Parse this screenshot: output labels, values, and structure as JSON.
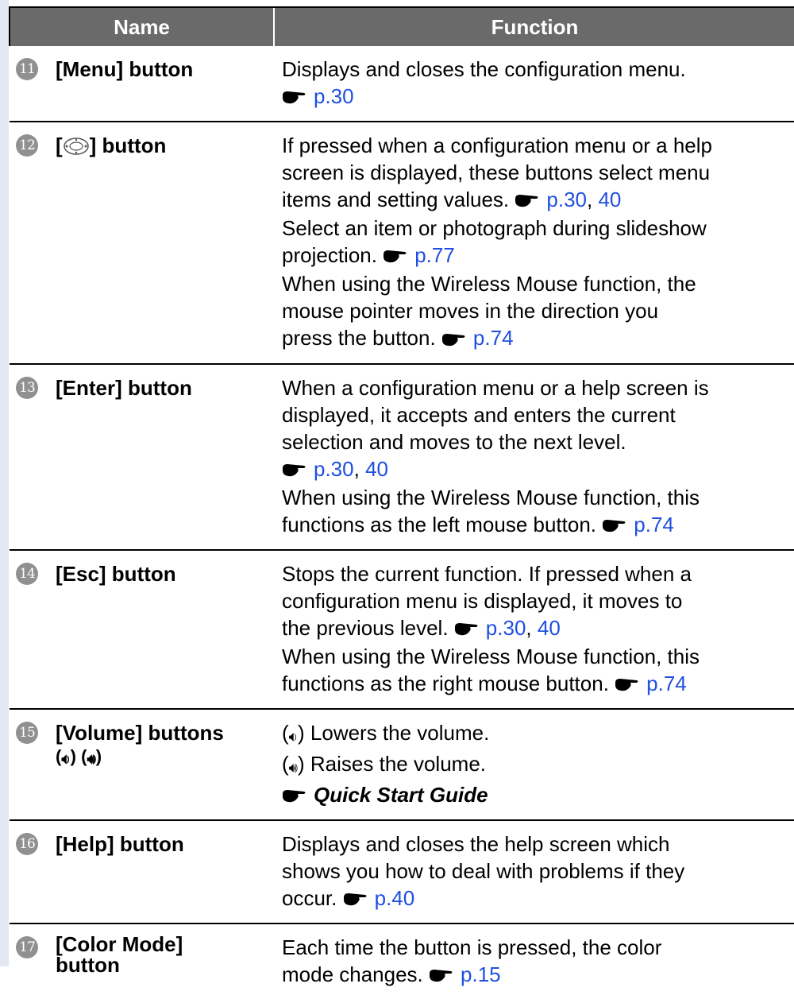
{
  "table": {
    "headers": {
      "name": "Name",
      "function": "Function"
    },
    "rows": [
      {
        "num": "11",
        "name": "[Menu] button",
        "lines": [
          "Displays and closes the configuration menu."
        ],
        "ref_lines": [
          [
            "p.30"
          ]
        ]
      },
      {
        "num": "12",
        "name_prefix": "[",
        "name_suffix": "] button",
        "lines": [
          "If pressed when a configuration menu or a help",
          "screen is displayed, these buttons select menu",
          "items and setting values.",
          "Select an item or photograph during slideshow",
          "projection.",
          "When using the Wireless Mouse function, the",
          "mouse pointer moves in the direction you",
          "press the button."
        ],
        "refs": {
          "a": "p.30",
          "b": "40",
          "c": "p.77",
          "d": "p.74"
        }
      },
      {
        "num": "13",
        "name": "[Enter] button",
        "lines": [
          "When a configuration menu or a help screen is",
          "displayed, it accepts and enters the current",
          "selection and moves to the next level.",
          "When using the Wireless Mouse function, this",
          "functions as the left mouse button."
        ],
        "refs": {
          "a": "p.30",
          "b": "40",
          "c": "p.74"
        }
      },
      {
        "num": "14",
        "name": "[Esc] button",
        "lines": [
          "Stops the current function. If pressed when a",
          "configuration menu is displayed, it moves to",
          "the previous level.",
          "When using the Wireless Mouse function, this",
          "functions as the right mouse button."
        ],
        "refs": {
          "a": "p.30",
          "b": "40",
          "c": "p.74"
        }
      },
      {
        "num": "15",
        "name_line1": "[Volume] buttons",
        "name_line2": "( ) ( )",
        "lines": [
          ") Lowers the volume.",
          ") Raises the volume."
        ],
        "guide": "Quick Start Guide"
      },
      {
        "num": "16",
        "name": "[Help] button",
        "lines": [
          "Displays and closes the help screen which",
          "shows you how to deal with problems if they",
          "occur."
        ],
        "refs": {
          "a": "p.40"
        }
      },
      {
        "num": "17",
        "name_line1": "[Color Mode]",
        "name_line2": "button",
        "lines": [
          "Each time the button is pressed, the color",
          "mode changes."
        ],
        "refs": {
          "a": "p.15"
        }
      }
    ]
  }
}
